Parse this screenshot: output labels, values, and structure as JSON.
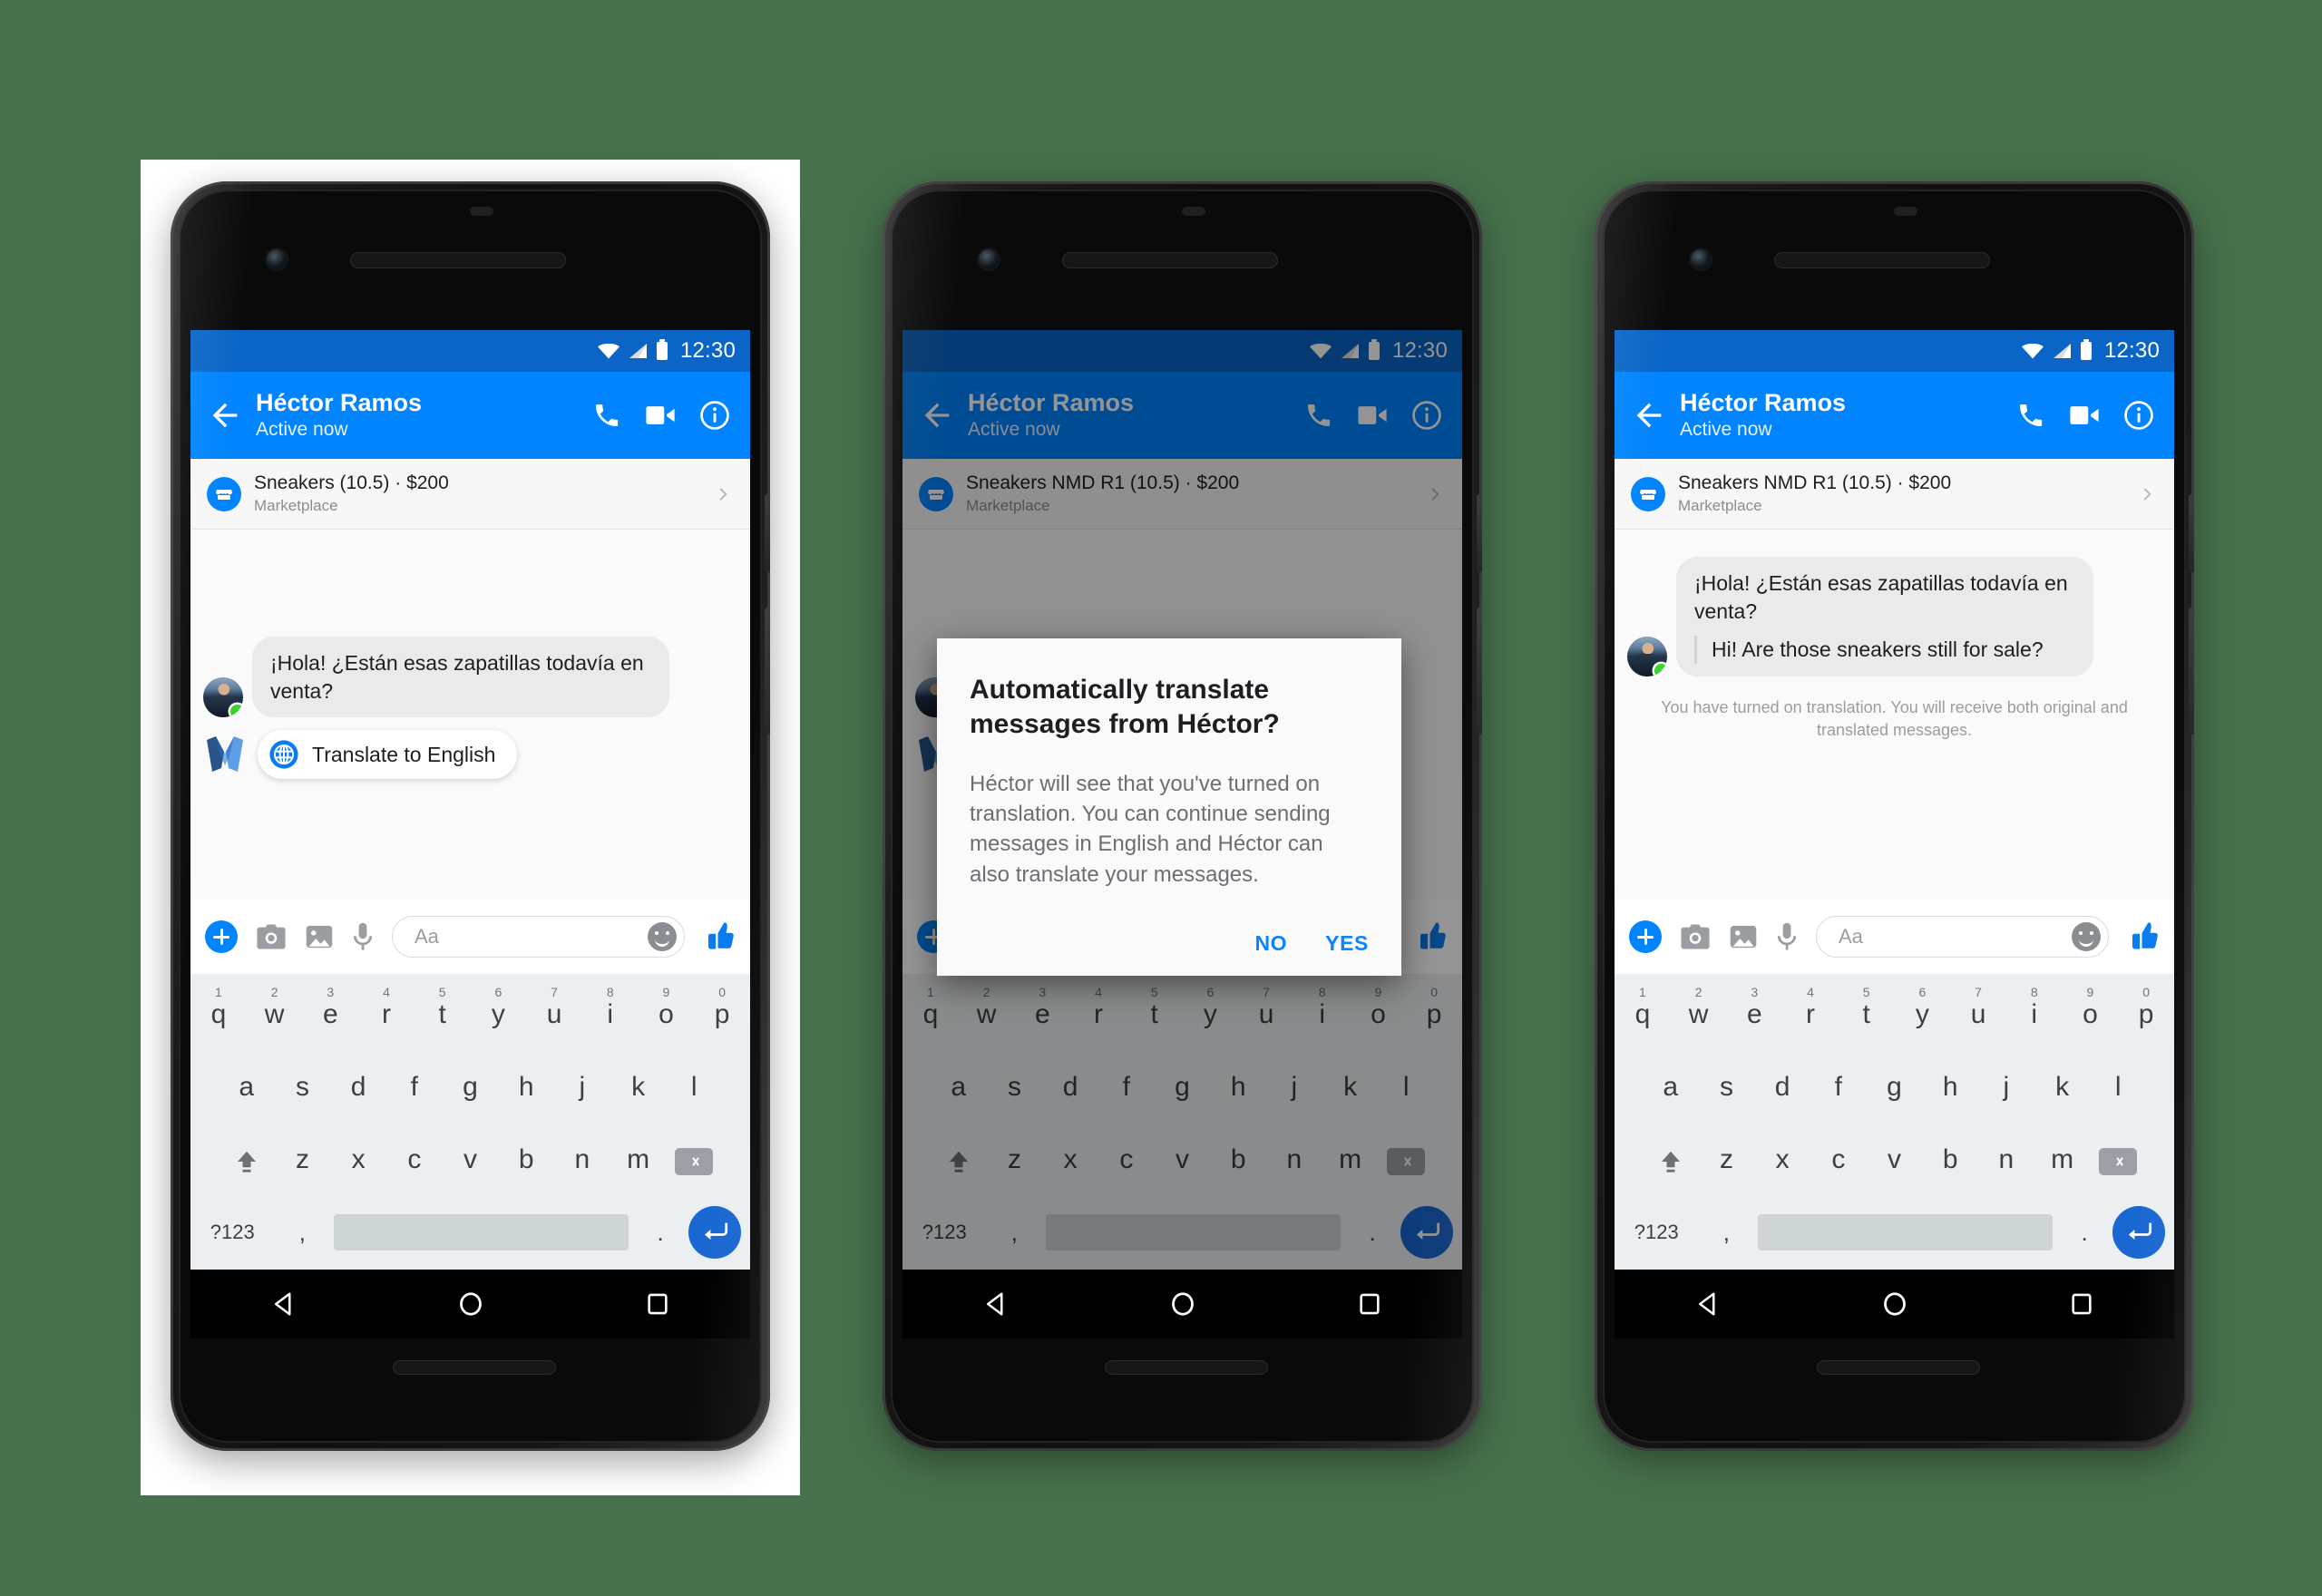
{
  "background_color": "#47714c",
  "accent_color": "#0084ff",
  "status_bar": {
    "time": "12:30",
    "icons": [
      "wifi-icon",
      "cellular-icon",
      "battery-icon"
    ]
  },
  "header": {
    "back_icon": "back-arrow-icon",
    "name": "Héctor Ramos",
    "status": "Active now",
    "actions": [
      "phone-call-icon",
      "video-call-icon",
      "info-icon"
    ]
  },
  "marketplace": {
    "icon": "marketplace-storefront-icon",
    "title_short": "Sneakers (10.5) · $200",
    "title_full": "Sneakers NMD R1 (10.5) · $200",
    "subtitle": "Marketplace",
    "chevron": "chevron-right-icon"
  },
  "chat": {
    "original_message": "¡Hola! ¿Están esas zapatillas todavía en venta?",
    "translated_message": "Hi! Are those sneakers still for sale?",
    "system_note": "You have turned on translation. You will receive both original and translated messages.",
    "avatar_name": "hector-avatar",
    "online_badge": "online-status-dot"
  },
  "suggestion": {
    "bot_logo": "messenger-m-logo-icon",
    "globe_icon": "globe-icon",
    "label": "Translate to English"
  },
  "composer": {
    "plus": "plus-button",
    "camera": "camera-icon",
    "gallery": "photo-gallery-icon",
    "mic": "microphone-icon",
    "placeholder": "Aa",
    "emoji": "emoji-smiley-icon",
    "like": "thumbs-up-icon"
  },
  "dialog": {
    "title": "Automatically translate messages from Héctor?",
    "body": "Héctor will see that you've turned on translation. You can continue sending messages in English and Héctor can also translate your messages.",
    "no_label": "NO",
    "yes_label": "YES"
  },
  "keyboard": {
    "row1": [
      {
        "letter": "q",
        "num": "1"
      },
      {
        "letter": "w",
        "num": "2"
      },
      {
        "letter": "e",
        "num": "3"
      },
      {
        "letter": "r",
        "num": "4"
      },
      {
        "letter": "t",
        "num": "5"
      },
      {
        "letter": "y",
        "num": "6"
      },
      {
        "letter": "u",
        "num": "7"
      },
      {
        "letter": "i",
        "num": "8"
      },
      {
        "letter": "o",
        "num": "9"
      },
      {
        "letter": "p",
        "num": "0"
      }
    ],
    "row2": [
      "a",
      "s",
      "d",
      "f",
      "g",
      "h",
      "j",
      "k",
      "l"
    ],
    "row3": [
      "z",
      "x",
      "c",
      "v",
      "b",
      "n",
      "m"
    ],
    "shift": "shift-key-icon",
    "backspace": "backspace-key-icon",
    "symbols_label": "?123",
    "comma": ",",
    "period": ".",
    "enter": "enter-key-icon"
  },
  "navbar": {
    "back": "nav-back-triangle-icon",
    "home": "nav-home-circle-icon",
    "recents": "nav-recents-square-icon"
  },
  "phones": [
    {
      "id": "phone-1",
      "state": "translate-suggestion"
    },
    {
      "id": "phone-2",
      "state": "confirm-dialog"
    },
    {
      "id": "phone-3",
      "state": "translation-enabled"
    }
  ]
}
